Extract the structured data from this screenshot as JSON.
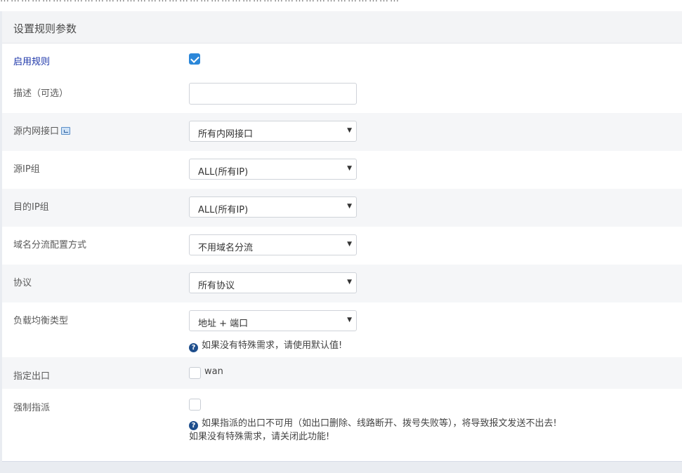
{
  "top_strip_text": "……………………………………………………………………………………………………",
  "panel": {
    "title": "设置规则参数"
  },
  "rows": {
    "enable": {
      "label": "启用规则",
      "checked": true
    },
    "description": {
      "label": "描述（可选）",
      "value": "",
      "placeholder": ""
    },
    "src_interface": {
      "label": "源内网接口",
      "icon": "interface-info-icon",
      "value": "所有内网接口"
    },
    "src_ip_group": {
      "label": "源IP组",
      "value": "ALL(所有IP)"
    },
    "dst_ip_group": {
      "label": "目的IP组",
      "value": "ALL(所有IP)"
    },
    "domain_mode": {
      "label": "域名分流配置方式",
      "value": "不用域名分流"
    },
    "protocol": {
      "label": "协议",
      "value": "所有协议"
    },
    "lb_type": {
      "label": "负载均衡类型",
      "value": "地址 + 端口",
      "hint": "如果没有特殊需求，请使用默认值!"
    },
    "outlet": {
      "label": "指定出口",
      "option": "wan",
      "checked": false
    },
    "force": {
      "label": "强制指派",
      "checked": false,
      "hint_line1": "如果指派的出口不可用（如出口删除、线路断开、拨号失败等），将导致报文发送不出去!",
      "hint_line2": "如果没有特殊需求，请关闭此功能!"
    }
  },
  "colors": {
    "accent": "#2b87d9",
    "link_label": "#1a33a8",
    "alt_row": "#f5f6f8",
    "help_icon": "#1e4e8c"
  }
}
